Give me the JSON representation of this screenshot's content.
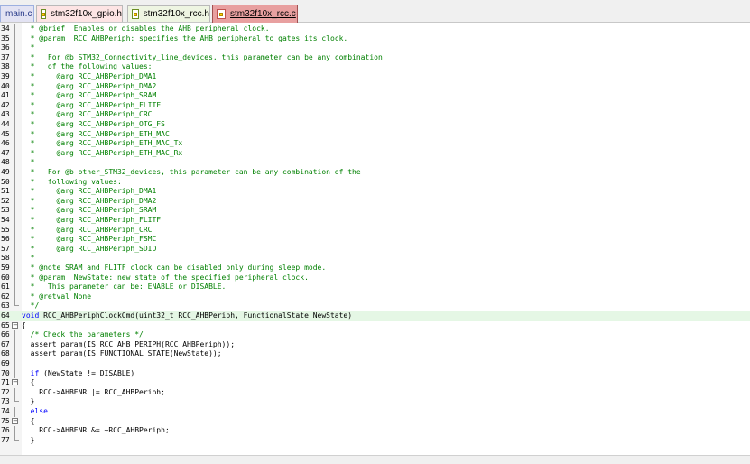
{
  "tabs": [
    {
      "label": "main.c"
    },
    {
      "label": "stm32f10x_gpio.h"
    },
    {
      "label": "stm32f10x_rcc.h"
    },
    {
      "label": "stm32f10x_rcc.c"
    }
  ],
  "active_tab": "stm32f10x_rcc.c",
  "colors": {
    "comment": "#008000",
    "keyword": "#0000ff",
    "current_line": "#e5f7e5",
    "active_tab": "#e8a0a0"
  },
  "lines": [
    {
      "n": "34",
      "t": "  * @brief  Enables or disables the AHB peripheral clock."
    },
    {
      "n": "35",
      "t": "  * @param  RCC_AHBPeriph: specifies the AHB peripheral to gates its clock."
    },
    {
      "n": "36",
      "t": "  *"
    },
    {
      "n": "37",
      "t": "  *   For @b STM32_Connectivity_line_devices, this parameter can be any combination"
    },
    {
      "n": "38",
      "t": "  *   of the following values:"
    },
    {
      "n": "39",
      "t": "  *     @arg RCC_AHBPeriph_DMA1"
    },
    {
      "n": "40",
      "t": "  *     @arg RCC_AHBPeriph_DMA2"
    },
    {
      "n": "41",
      "t": "  *     @arg RCC_AHBPeriph_SRAM"
    },
    {
      "n": "42",
      "t": "  *     @arg RCC_AHBPeriph_FLITF"
    },
    {
      "n": "43",
      "t": "  *     @arg RCC_AHBPeriph_CRC"
    },
    {
      "n": "44",
      "t": "  *     @arg RCC_AHBPeriph_OTG_FS"
    },
    {
      "n": "45",
      "t": "  *     @arg RCC_AHBPeriph_ETH_MAC"
    },
    {
      "n": "46",
      "t": "  *     @arg RCC_AHBPeriph_ETH_MAC_Tx"
    },
    {
      "n": "47",
      "t": "  *     @arg RCC_AHBPeriph_ETH_MAC_Rx"
    },
    {
      "n": "48",
      "t": "  *"
    },
    {
      "n": "49",
      "t": "  *   For @b other_STM32_devices, this parameter can be any combination of the"
    },
    {
      "n": "50",
      "t": "  *   following values:"
    },
    {
      "n": "51",
      "t": "  *     @arg RCC_AHBPeriph_DMA1"
    },
    {
      "n": "52",
      "t": "  *     @arg RCC_AHBPeriph_DMA2"
    },
    {
      "n": "53",
      "t": "  *     @arg RCC_AHBPeriph_SRAM"
    },
    {
      "n": "54",
      "t": "  *     @arg RCC_AHBPeriph_FLITF"
    },
    {
      "n": "55",
      "t": "  *     @arg RCC_AHBPeriph_CRC"
    },
    {
      "n": "56",
      "t": "  *     @arg RCC_AHBPeriph_FSMC"
    },
    {
      "n": "57",
      "t": "  *     @arg RCC_AHBPeriph_SDIO"
    },
    {
      "n": "58",
      "t": "  *"
    },
    {
      "n": "59",
      "t": "  * @note SRAM and FLITF clock can be disabled only during sleep mode."
    },
    {
      "n": "60",
      "t": "  * @param  NewState: new state of the specified peripheral clock."
    },
    {
      "n": "61",
      "t": "  *   This parameter can be: ENABLE or DISABLE."
    },
    {
      "n": "62",
      "t": "  * @retval None"
    },
    {
      "n": "63",
      "t": "  */"
    },
    {
      "n": "64",
      "kw": "void",
      "t": " RCC_AHBPeriphClockCmd(uint32_t RCC_AHBPeriph, FunctionalState NewState)"
    },
    {
      "n": "65",
      "t": "{"
    },
    {
      "n": "66",
      "cm": "  /* Check the parameters */"
    },
    {
      "n": "67",
      "t": "  assert_param(IS_RCC_AHB_PERIPH(RCC_AHBPeriph));"
    },
    {
      "n": "68",
      "t": "  assert_param(IS_FUNCTIONAL_STATE(NewState));"
    },
    {
      "n": "69",
      "t": ""
    },
    {
      "n": "70",
      "kw": "  if",
      "t": " (NewState != DISABLE)"
    },
    {
      "n": "71",
      "t": "  {"
    },
    {
      "n": "72",
      "t": "    RCC->AHBENR |= RCC_AHBPeriph;"
    },
    {
      "n": "73",
      "t": "  }"
    },
    {
      "n": "74",
      "kw": "  else",
      "t": ""
    },
    {
      "n": "75",
      "t": "  {"
    },
    {
      "n": "76",
      "t": "    RCC->AHBENR &= ~RCC_AHBPeriph;"
    },
    {
      "n": "77",
      "t": "  }"
    }
  ]
}
